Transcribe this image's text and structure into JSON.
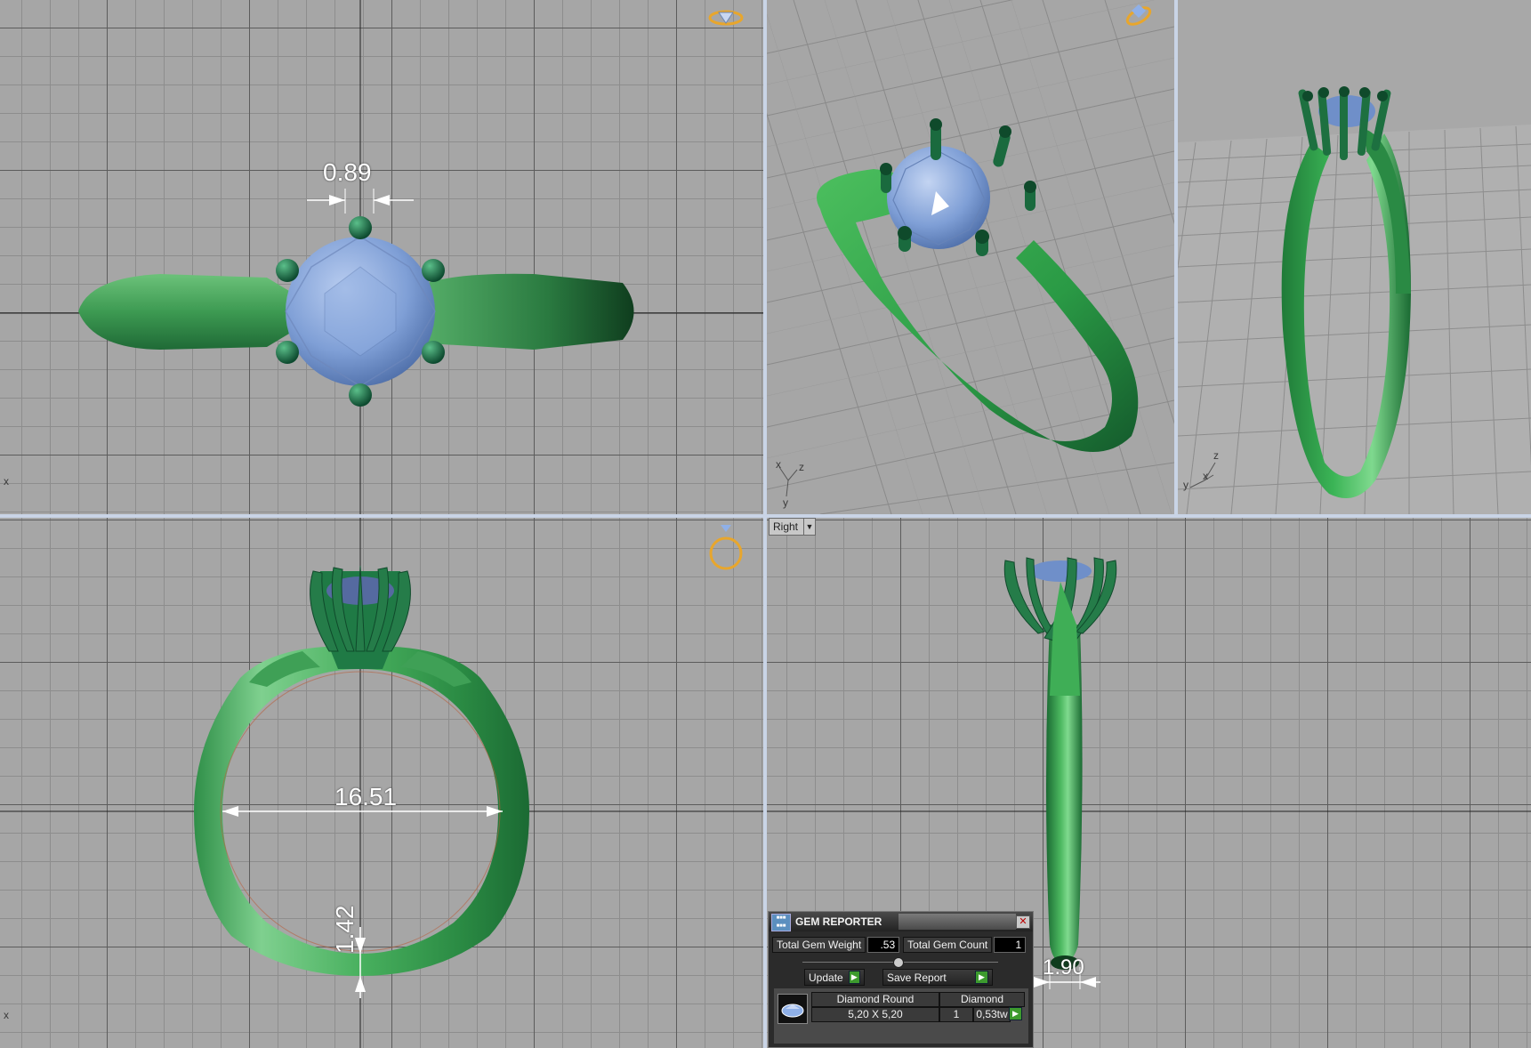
{
  "viewports": {
    "top": {
      "dimension": "0.89",
      "axis": "x"
    },
    "perspective": {
      "axis_x": "x",
      "axis_y": "y",
      "axis_z": "z"
    },
    "threed": {
      "axis_x": "x",
      "axis_y": "y",
      "axis_z": "z"
    },
    "front": {
      "dimension_inner": "16.51",
      "dimension_thickness": "1.42",
      "axis": "x"
    },
    "right": {
      "view_label": "Right",
      "dimension": "1.90"
    }
  },
  "gem_reporter": {
    "title": "GEM REPORTER",
    "total_weight_label": "Total Gem Weight",
    "total_weight_value": ".53",
    "total_count_label": "Total Gem Count",
    "total_count_value": "1",
    "update_label": "Update",
    "save_report_label": "Save Report",
    "row": {
      "shape": "Diamond Round",
      "material": "Diamond",
      "size": "5,20 X 5,20",
      "count": "1",
      "weight": "0,53tw"
    }
  },
  "colors": {
    "metal": "#2f9a4a",
    "metal_dark": "#145a2c",
    "gem": "#7f9fd6",
    "viewport_bg": "#a6a6a6",
    "separator": "#c9d4e6"
  }
}
